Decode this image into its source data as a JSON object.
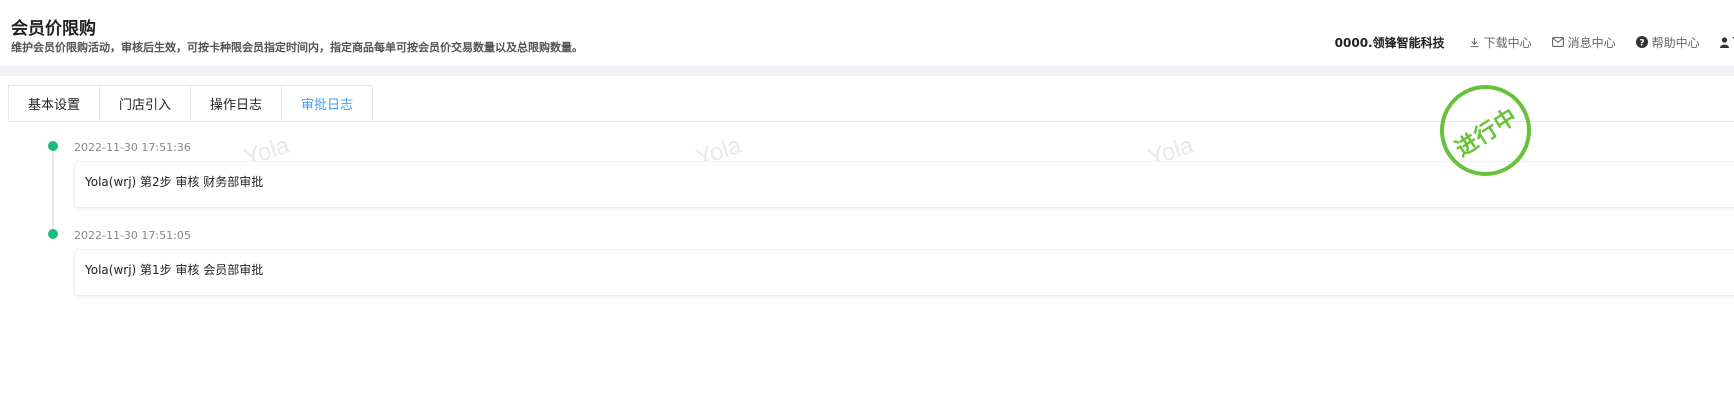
{
  "header": {
    "title": "会员价限购",
    "subtitle": "维护会员价限购活动，审核后生效，可按卡种限会员指定时间内，指定商品每单可按会员价交易数量以及总限购数量。"
  },
  "topnav": {
    "company": "0000.领锋智能科技",
    "download": "下载中心",
    "messages": "消息中心",
    "help": "帮助中心",
    "user": "Y"
  },
  "tabs": [
    {
      "label": "基本设置"
    },
    {
      "label": "门店引入"
    },
    {
      "label": "操作日志"
    },
    {
      "label": "审批日志"
    }
  ],
  "watermark": "Yola",
  "timeline": [
    {
      "time": "2022-11-30 17:51:36",
      "content": "Yola(wrj) 第2步 审核 财务部审批"
    },
    {
      "time": "2022-11-30 17:51:05",
      "content": "Yola(wrj) 第1步 审核 会员部审批"
    }
  ],
  "stamp": {
    "text": "进行中"
  },
  "colors": {
    "accent": "#409eff",
    "dot": "#1bbc7a",
    "stamp": "#67c23a"
  }
}
